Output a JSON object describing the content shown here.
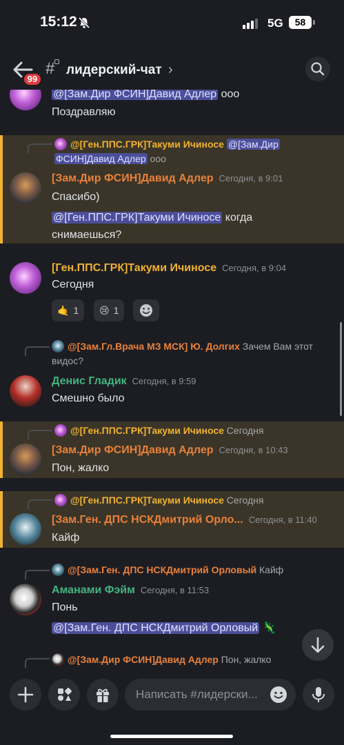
{
  "status": {
    "time": "15:12",
    "network": "5G",
    "battery": "58"
  },
  "header": {
    "badge_count": "99",
    "channel_title": "лидерский-чат",
    "chevron": "›"
  },
  "messages": [
    {
      "text_mention": "@[Зам.Дир ФСИН]Давид Адлер",
      "text_after": " ооо",
      "line2": "Поздравляю"
    },
    {
      "reply_name": "@[Ген.ППС.ГРК]Такуми Ичиносе",
      "reply_mention_a": "@[Зам.Дир",
      "reply_mention_b": "ФСИН]Давид Адлер",
      "reply_tail": " ооо",
      "author": "[Зам.Дир ФСИН]Давид Адлер",
      "timestamp": "Сегодня, в 9:01",
      "line1": "Спасибо)",
      "mention": "@[Ген.ППС.ГРК]Такуми Ичиносе",
      "after_mention": " когда",
      "line3": "снимаешься?"
    },
    {
      "author": "[Ген.ППС.ГРК]Такуми Ичиносе",
      "timestamp": "Сегодня, в 9:04",
      "line1": "Сегодня",
      "reactions": [
        {
          "emoji": "🤙",
          "count": "1"
        },
        {
          "emoji": "😢",
          "count": "1"
        }
      ]
    },
    {
      "reply_name": "@[Зам.Гл.Врача МЗ МСК] Ю. Долгих",
      "reply_text": " Зачем Вам этот",
      "reply_text2": "видос?",
      "author": "Денис Гладик",
      "timestamp": "Сегодня, в 9:59",
      "line1": "Смешно было"
    },
    {
      "reply_name": "@[Ген.ППС.ГРК]Такуми Ичиносе",
      "reply_text": " Сегодня",
      "author": "[Зам.Дир ФСИН]Давид Адлер",
      "timestamp": "Сегодня, в 10:43",
      "line1": "Пон, жалко"
    },
    {
      "reply_name": "@[Ген.ППС.ГРК]Такуми Ичиносе",
      "reply_text": " Сегодня",
      "author": "[Зам.Ген. ДПС НСКДмитрий Орло...",
      "timestamp": "Сегодня, в 11:40",
      "line1": "Кайф"
    },
    {
      "reply_name": "@[Зам.Ген. ДПС НСКДмитрий Орловый",
      "reply_text": " Кайф",
      "author": "Аманами Фэйм",
      "timestamp": "Сегодня, в 11:53",
      "line1": "Понь",
      "mention": "@[Зам.Ген. ДПС НСКДмитрий Орловый",
      "sticker": "🦎"
    },
    {
      "reply_name": "@[Зам.Дир ФСИН]Давид Адлер",
      "reply_text": " Пон, жалко"
    }
  ],
  "input": {
    "placeholder": "Написать #лидерски..."
  },
  "colors": {
    "highlight_bg": "#3a3528",
    "highlight_bar": "#f0b232",
    "mention_bg": "#4b4f9a",
    "background": "#1c1d22"
  }
}
